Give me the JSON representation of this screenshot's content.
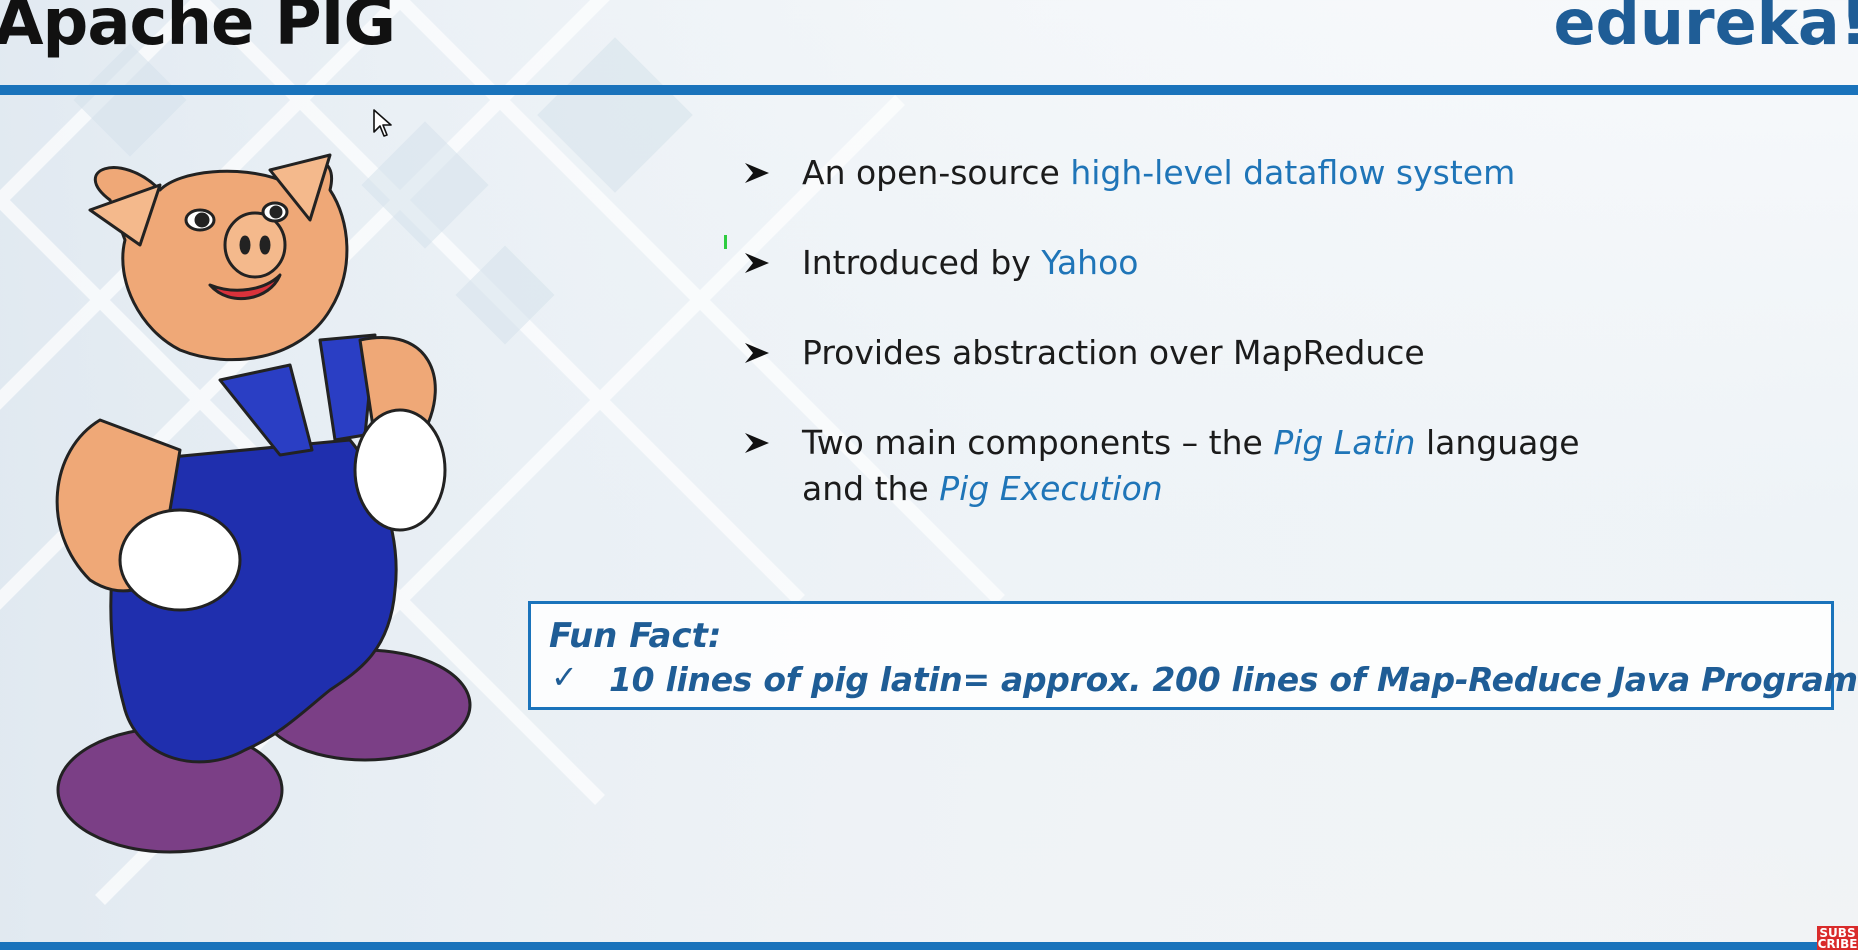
{
  "header": {
    "title": "Apache PIG",
    "brand": "edureka!"
  },
  "bullets": [
    {
      "plain": "An open-source ",
      "highlight": "high-level dataflow system"
    },
    {
      "plain": "Introduced by ",
      "highlight": "Yahoo"
    },
    {
      "plain": "Provides abstraction over MapReduce"
    },
    {
      "part1": "Two main components – the ",
      "italic1": "Pig Latin",
      "part2": " language",
      "part3": "and the ",
      "italic2": "Pig Execution"
    }
  ],
  "fun_fact": {
    "title": "Fun Fact:",
    "check_icon": "✓",
    "text": "10 lines of pig latin= approx. 200 lines of Map-Reduce Java Program"
  },
  "subscribe": {
    "label": "SUBS CRIBE"
  },
  "colors": {
    "accent_blue": "#1a73bb",
    "text_blue": "#1f75b8",
    "brand_blue": "#1f5d96"
  }
}
